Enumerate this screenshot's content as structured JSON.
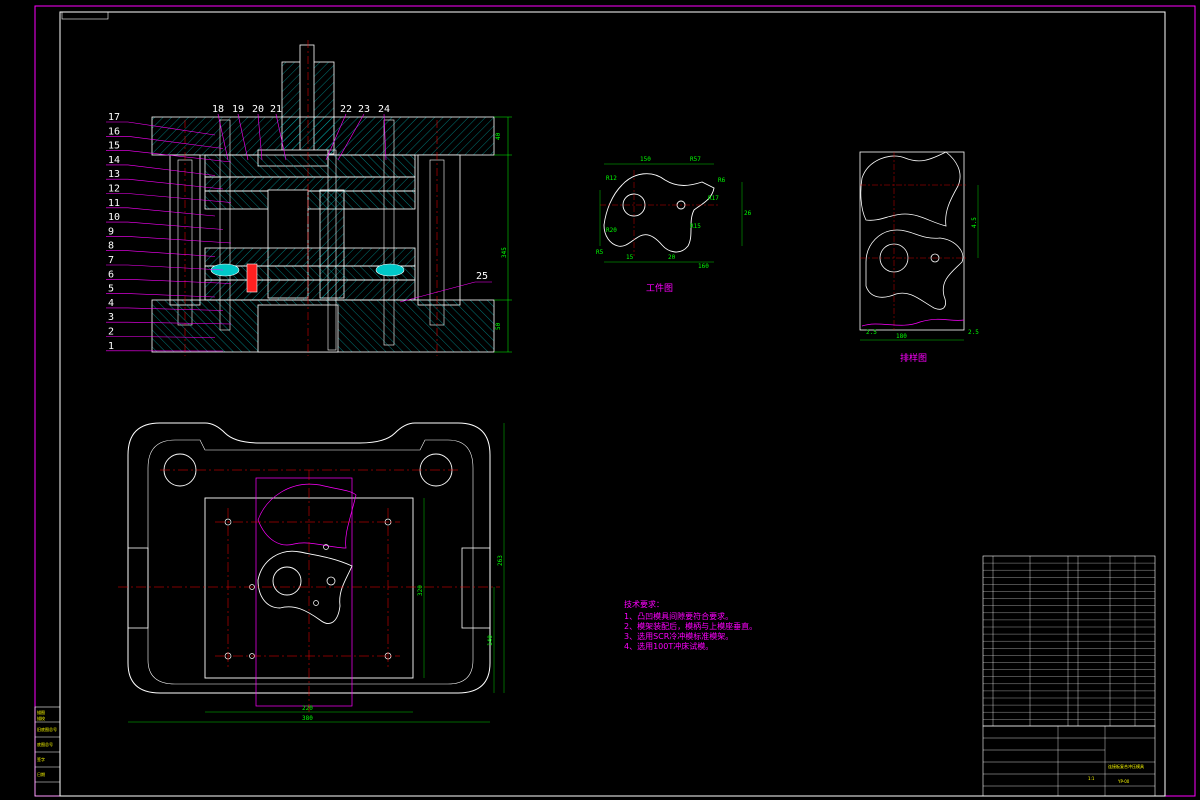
{
  "drawing": {
    "section_view": {
      "left_callouts": [
        "17",
        "16",
        "15",
        "14",
        "13",
        "12",
        "11",
        "10",
        "9",
        "8",
        "7",
        "6",
        "5",
        "4",
        "3",
        "2",
        "1"
      ],
      "top_callouts": [
        "18",
        "19",
        "20",
        "21",
        "22",
        "23",
        "24"
      ],
      "right_callout": "25",
      "dims": {
        "d1": "40",
        "d2": "345",
        "d3": "50"
      }
    },
    "part_view": {
      "caption": "工件图",
      "dims": [
        "150",
        "R57",
        "R12",
        "R17",
        "R15",
        "R20",
        "R6",
        "R5",
        "15",
        "20",
        "26",
        "160"
      ]
    },
    "strip_view": {
      "caption": "排样图",
      "dims": [
        "180",
        "2.5",
        "2.5",
        "4.5"
      ]
    },
    "plan_view": {
      "dims": {
        "width_inner": "220",
        "width_outer": "380",
        "height_inner": "320",
        "height_outer": "263",
        "side": "140"
      }
    },
    "requirements": {
      "title": "技术要求：",
      "items": [
        "1、凸凹模具间隙要符合要求。",
        "2、模架装配后，模柄与上模座垂直。",
        "3、选用SCR冷冲模标准模架。",
        "4、选用100T冲床试模。"
      ]
    },
    "left_stamp": [
      "描图",
      "描校",
      "旧底图总号",
      "底图总号",
      "签字",
      "日期"
    ],
    "title_block": {
      "drawing_title": "连接板复合冲压模具",
      "drawing_no": "YP-00",
      "material": "",
      "scale": "1:1"
    }
  },
  "colors": {
    "frame": "#ff00ff",
    "geometry": "#ffffff",
    "hatch": "#00ffff",
    "centerline": "#ff0000",
    "dimension": "#00ff00",
    "titleblock_text": "#ffff00"
  }
}
